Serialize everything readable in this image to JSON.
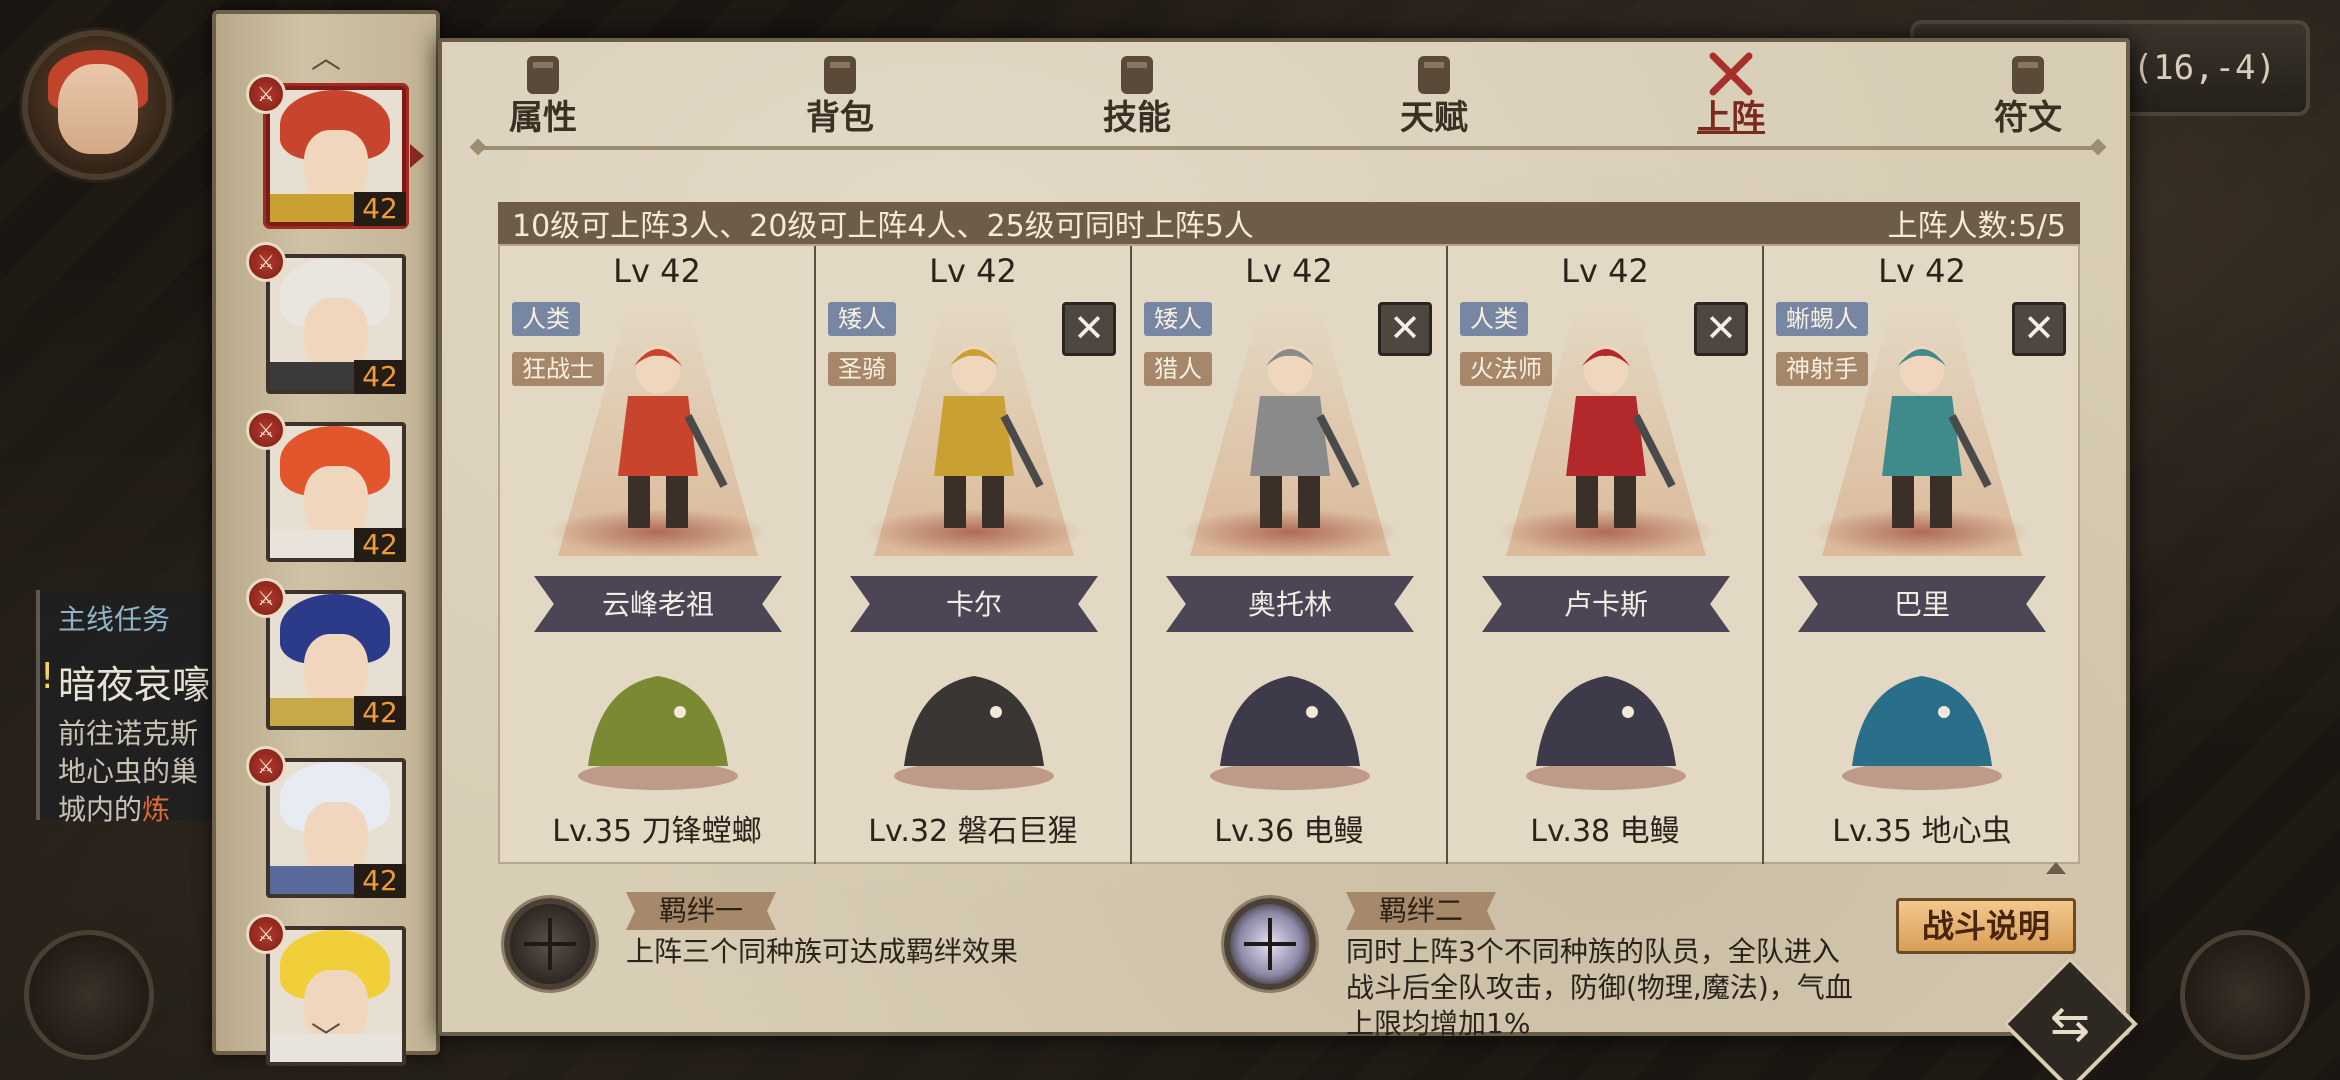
{
  "hud": {
    "coords": "(16,-4)"
  },
  "quest": {
    "header": "主线任务",
    "title": "暗夜哀嚎",
    "line1": "前往诺克斯",
    "line2": "地心虫的巢",
    "line3_a": "城内的",
    "line3_b": "炼"
  },
  "strip": {
    "up_arrow": "︿",
    "down_arrow": "﹀",
    "characters": [
      {
        "level": "42",
        "hair": "#c9442c",
        "body": "#c9a032",
        "selected": true
      },
      {
        "level": "42",
        "hair": "#e9e6e0",
        "body": "#3a3a3a",
        "selected": false
      },
      {
        "level": "42",
        "hair": "#e2552d",
        "body": "#e8e4dc",
        "selected": false
      },
      {
        "level": "42",
        "hair": "#2c3a8a",
        "body": "#c7a94a",
        "selected": false
      },
      {
        "level": "42",
        "hair": "#e6ecf2",
        "body": "#5a6a9a",
        "selected": false
      },
      {
        "level": "",
        "hair": "#f1cf3a",
        "body": "#e8e4dc",
        "selected": false
      }
    ]
  },
  "tabs": [
    {
      "label": "属性",
      "icon": "flame-icon"
    },
    {
      "label": "背包",
      "icon": "backpack-icon"
    },
    {
      "label": "技能",
      "icon": "book-icon"
    },
    {
      "label": "天赋",
      "icon": "eye-icon"
    },
    {
      "label": "上阵",
      "icon": "crossed-swords-icon",
      "active": true
    },
    {
      "label": "符文",
      "icon": "rune-icon"
    }
  ],
  "info": {
    "rule": "10级可上阵3人、20级可上阵4人、25级可同时上阵5人",
    "count": "上阵人数:5/5"
  },
  "slots": [
    {
      "level": "Lv 42",
      "race": "人类",
      "cls": "狂战士",
      "name": "云峰老祖",
      "pet": "Lv.35 刀锋螳螂",
      "removable": false,
      "hero_color": "#c9442c",
      "pet_color": "#7a8a32"
    },
    {
      "level": "Lv 42",
      "race": "矮人",
      "cls": "圣骑",
      "name": "卡尔",
      "pet": "Lv.32 磐石巨猩",
      "removable": true,
      "hero_color": "#c9a032",
      "pet_color": "#3a3634"
    },
    {
      "level": "Lv 42",
      "race": "矮人",
      "cls": "猎人",
      "name": "奥托林",
      "pet": "Lv.36 电鳗",
      "removable": true,
      "hero_color": "#8a8a8a",
      "pet_color": "#3d3a4a"
    },
    {
      "level": "Lv 42",
      "race": "人类",
      "cls": "火法师",
      "name": "卢卡斯",
      "pet": "Lv.38 电鳗",
      "removable": true,
      "hero_color": "#b3282a",
      "pet_color": "#3d3a4a"
    },
    {
      "level": "Lv 42",
      "race": "蜥蜴人",
      "cls": "神射手",
      "name": "巴里",
      "pet": "Lv.35 地心虫",
      "removable": true,
      "hero_color": "#3f8a8a",
      "pet_color": "#2a6f8a"
    }
  ],
  "bonds": {
    "one": {
      "title": "羁绊一",
      "desc": "上阵三个同种族可达成羁绊效果"
    },
    "two": {
      "title": "羁绊二",
      "desc1": "同时上阵3个不同种族的队员，全队进入",
      "desc2": "战斗后全队攻击，防御(物理,魔法)，气血",
      "desc3": "上限均增加1%"
    }
  },
  "buttons": {
    "battle_info": "战斗说明",
    "remove": "✕",
    "swap": "⇆"
  },
  "colors": {
    "panel": "#d8cdb5",
    "info_bar": "#6d5d48",
    "active_tab": "#7b2a20",
    "race_tag": "#7787a3",
    "class_tag": "#a6876a",
    "level_text": "#f09a35"
  }
}
